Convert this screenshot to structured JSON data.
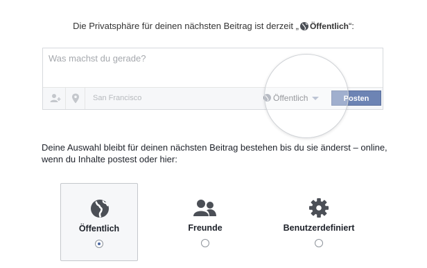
{
  "intro": {
    "prefix": "Die Privatsphäre für deinen nächsten Beitrag ist derzeit „",
    "privacy": "Öffentlich",
    "suffix": "“:"
  },
  "composer": {
    "placeholder": "Was machst du gerade?",
    "location": "San Francisco",
    "privacy_label": "Öffentlich",
    "post_button": "Posten"
  },
  "description": "Deine Auswahl bleibt für deinen nächsten Beitrag bestehen bis du sie änderst – online, wenn du Inhalte postest oder hier:",
  "options": [
    {
      "label": "Öffentlich",
      "icon": "globe-icon",
      "selected": true
    },
    {
      "label": "Freunde",
      "icon": "friends-icon",
      "selected": false
    },
    {
      "label": "Benutzerdefiniert",
      "icon": "gear-icon",
      "selected": false
    }
  ],
  "colors": {
    "post_button": "#6d84b4",
    "icon": "#4b4f56",
    "radio_selected": "#4b67a1"
  }
}
